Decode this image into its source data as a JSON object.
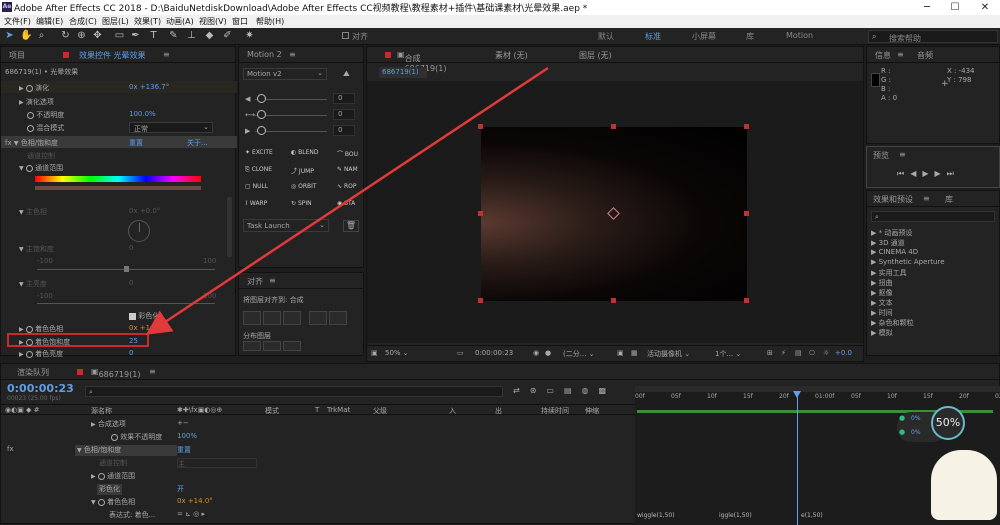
{
  "app": {
    "title": "Adobe After Effects CC 2018 - D:\\BaiduNetdiskDownload\\Adobe After Effects CC视频教程\\教程素材+插件\\基础课素材\\光晕效果.aep *",
    "logo": "Ae"
  },
  "window_controls": {
    "minimize": "─",
    "maximize": "☐",
    "close": "✕"
  },
  "menu": [
    "文件(F)",
    "编辑(E)",
    "合成(C)",
    "图层(L)",
    "效果(T)",
    "动画(A)",
    "视图(V)",
    "窗口",
    "帮助(H)"
  ],
  "toolbar": {
    "align_checkbox": "对齐",
    "workspaces": [
      "默认",
      "标准",
      "小屏幕",
      "库",
      "Motion"
    ],
    "active_workspace": "标准",
    "search_placeholder": "搜索帮助"
  },
  "effect_panel": {
    "tab_project": "项目",
    "tab_effects": "效果控件 光晕效果",
    "menu_glyph": "≡",
    "layer_label": "686719(1) • 光晕效果",
    "rows": [
      {
        "label": "演化",
        "value": "0x +136.7°"
      },
      {
        "label": "演化选项",
        "value": ""
      },
      {
        "label": "不透明度",
        "value": "100.0%"
      },
      {
        "label": "混合模式",
        "value": "正常"
      },
      {
        "label": "色相/饱和度",
        "value": "重置",
        "extra": "关于..."
      },
      {
        "label": "通道控制",
        "value": ""
      },
      {
        "label": "通道范围",
        "value": ""
      },
      {
        "label": "主色相",
        "value": "0x +0.0°"
      },
      {
        "label": "主饱和度",
        "value": "0"
      },
      {
        "label": "主亮度",
        "value": "0"
      },
      {
        "label": "彩色化",
        "value": ""
      },
      {
        "label": "着色色相",
        "value": "0x +14.0°"
      },
      {
        "label": "着色饱和度",
        "value": "25"
      },
      {
        "label": "着色亮度",
        "value": "0"
      }
    ],
    "slider_min": "-100",
    "slider_max": "100",
    "fx": "fx"
  },
  "motion_panel": {
    "tab": "Motion 2",
    "version": "Motion v2",
    "values": [
      "0",
      "0",
      "0"
    ],
    "buttons": [
      "EXCITE",
      "BLEND",
      "BOU",
      "CLONE",
      "JUMP",
      "NAM",
      "NULL",
      "ORBIT",
      "ROP",
      "WARP",
      "SPIN",
      "STA"
    ],
    "task": "Task Launch"
  },
  "align_panel": {
    "tab": "对齐",
    "align_to_label": "将图层对齐到:",
    "align_to": "合成",
    "distribute": "分布图层"
  },
  "comp_panel": {
    "tab": "合成 686719(1)",
    "footage": "素材 (无)",
    "layer": "图层 (无)",
    "subtab": "686719(1)",
    "footer": {
      "zoom": "50%",
      "time": "0:00:00:23",
      "resolution": "(二分...",
      "camera": "活动摄像机",
      "views": "1个...",
      "offset": "+0.0"
    }
  },
  "info_panel": {
    "tab_info": "信息",
    "tab_audio": "音频",
    "R": "R :",
    "G": "G :",
    "B": "B :",
    "A": "A : 0",
    "X": "X : -434",
    "Y": "Y : 798"
  },
  "preview_panel": {
    "tab": "预览"
  },
  "effects_presets": {
    "tab": "效果和预设",
    "tab_lib": "库",
    "items": [
      "* 动画预设",
      "3D 通道",
      "CINEMA 4D",
      "Synthetic Aperture",
      "实用工具",
      "扭曲",
      "抠像",
      "文本",
      "时间",
      "杂色和颗粒",
      "模拟"
    ]
  },
  "timeline": {
    "tab_render": "渲染队列",
    "tab_comp": "686719(1)",
    "timecode": "0:00:00:23",
    "frame_info": "00023 (25.00 fps)",
    "headers": [
      "源名称",
      "模式",
      "T",
      "TrkMat",
      "父级",
      "入",
      "出",
      "持续时间",
      "伸缩"
    ],
    "ticks": [
      "00f",
      "05f",
      "10f",
      "15f",
      "20f",
      "01:00f",
      "05f",
      "10f",
      "15f",
      "20f",
      "02:0"
    ],
    "rows": [
      {
        "label": "合成选项",
        "value": "+−"
      },
      {
        "label": "效果不透明度",
        "value": "100%"
      },
      {
        "label": "色相/饱和度",
        "value": "重置"
      },
      {
        "label": "通道控制",
        "value": "主"
      },
      {
        "label": "通道范围",
        "value": ""
      },
      {
        "label": "彩色化",
        "value": "开"
      },
      {
        "label": "着色色相",
        "value": "0x +14.0°"
      },
      {
        "label": "表达式: 着色...",
        "value": ""
      }
    ],
    "expressions": [
      "wiggle(1,50)",
      "iggle(1,50)",
      "e(1,50)"
    ],
    "val1": "0%",
    "val2": "0%",
    "zoom_badge": "50%",
    "zoom_suffix": "%"
  },
  "colors": {
    "accent": "#5f9fe8",
    "highlight": "#cc2a2a",
    "arrow": "#e03a3a"
  }
}
